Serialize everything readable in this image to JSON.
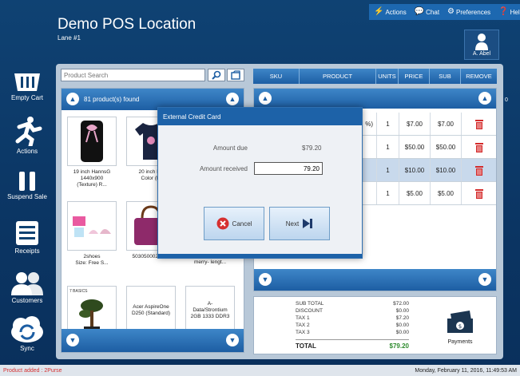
{
  "header": {
    "location_title": "Demo POS Location",
    "lane": "Lane #1",
    "top_buttons": [
      {
        "label": "Actions",
        "icon": "actions-icon"
      },
      {
        "label": "Chat",
        "icon": "chat-icon"
      },
      {
        "label": "Preferences",
        "icon": "gear-icon"
      },
      {
        "label": "Help",
        "icon": "help-icon"
      }
    ],
    "user": "A. Abel"
  },
  "nav": [
    {
      "label": "Empty Cart",
      "icon": "basket-icon"
    },
    {
      "label": "Actions",
      "icon": "running-person-icon"
    },
    {
      "label": "Suspend Sale",
      "icon": "pause-icon"
    },
    {
      "label": "Receipts",
      "icon": "receipt-icon"
    },
    {
      "label": "Customers",
      "icon": "customers-icon"
    },
    {
      "label": "Sync",
      "icon": "sync-icon"
    }
  ],
  "search": {
    "placeholder": "Product Search"
  },
  "products": {
    "found": "81 product(s) found",
    "tiles": [
      {
        "lines": [
          "19 inch HannsG",
          "1440x900",
          "(Texture) R..."
        ]
      },
      {
        "lines": [
          "20 inch Ha",
          "Color (M"
        ]
      },
      {
        "lines": [
          "2shoes",
          "Size: Free S..."
        ]
      },
      {
        "lines": [
          "5030500026000"
        ]
      },
      {
        "lines": [
          "(%)",
          "merry- lengt..."
        ]
      },
      {
        "lines": [],
        "thumb_text": "7 BASICS"
      },
      {
        "lines": [
          "Acer AspireOne",
          "D250 (Standard)"
        ]
      },
      {
        "lines": [
          "A-",
          "Data/Strontium",
          "2GB 1333 DDR3"
        ]
      }
    ]
  },
  "cart": {
    "columns": [
      "SKU",
      "PRODUCT",
      "UNITS",
      "PRICE",
      "SUB",
      "REMOVE"
    ],
    "rows": [
      {
        "product": "%)",
        "units": "1",
        "price": "$7.00",
        "sub": "$7.00",
        "selected": false
      },
      {
        "product": "",
        "units": "1",
        "price": "$50.00",
        "sub": "$50.00",
        "selected": false
      },
      {
        "product": "",
        "units": "1",
        "price": "$10.00",
        "sub": "$10.00",
        "selected": true
      },
      {
        "product": "",
        "units": "1",
        "price": "$5.00",
        "sub": "$5.00",
        "selected": false
      }
    ],
    "side_count": "0"
  },
  "totals": {
    "lines": [
      {
        "label": "SUB TOTAL",
        "value": "$72.00"
      },
      {
        "label": "DISCOUNT",
        "value": "$0.00"
      },
      {
        "label": "TAX 1",
        "value": "$7.20"
      },
      {
        "label": "TAX 2",
        "value": "$0.00"
      },
      {
        "label": "TAX 3",
        "value": "$0.00"
      }
    ],
    "total_label": "TOTAL",
    "total_value": "$79.20",
    "payments_label": "Payments"
  },
  "dialog": {
    "title": "External Credit Card",
    "amount_due_label": "Amount due",
    "amount_due_value": "$79.20",
    "amount_received_label": "Amount received",
    "amount_received_value": "79.20",
    "cancel_label": "Cancel",
    "next_label": "Next"
  },
  "status": {
    "message": "Product added : 2Purse",
    "datetime": "Monday, February 11, 2016, 11:49:53 AM"
  },
  "colors": {
    "accent": "#1d62a8",
    "total_green": "#2d8a2d",
    "status_red": "#d63030",
    "trash_red": "#d42a2a"
  }
}
